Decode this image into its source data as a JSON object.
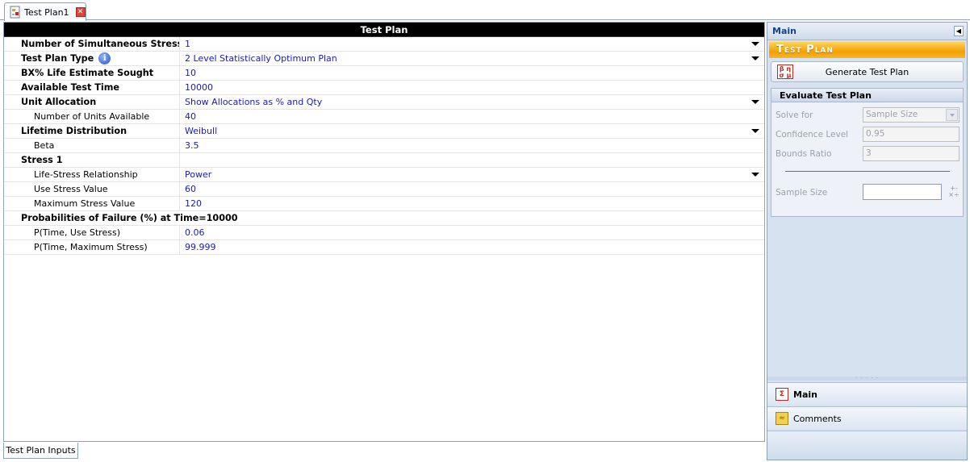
{
  "document_tab": {
    "label": "Test Plan1"
  },
  "grid": {
    "header": "Test Plan",
    "rows": [
      {
        "label": "Number of Simultaneous Stresses",
        "value": "1",
        "bold": true,
        "dropdown": true
      },
      {
        "label": "Test Plan Type",
        "value": "2 Level Statistically Optimum Plan",
        "bold": true,
        "dropdown": true,
        "info": true
      },
      {
        "label": "BX% Life Estimate Sought",
        "value": "10",
        "bold": true
      },
      {
        "label": "Available Test Time",
        "value": "10000",
        "bold": true
      },
      {
        "label": "Unit Allocation",
        "value": "Show Allocations as % and Qty",
        "bold": true,
        "dropdown": true
      },
      {
        "label": "Number of Units Available",
        "value": "40",
        "sub": true
      },
      {
        "label": "Lifetime Distribution",
        "value": "Weibull",
        "bold": true,
        "dropdown": true
      },
      {
        "label": "Beta",
        "value": "3.5",
        "sub": true
      },
      {
        "label": "Stress 1",
        "value": "",
        "bold": true
      },
      {
        "label": "Life-Stress Relationship",
        "value": "Power",
        "sub": true,
        "dropdown": true
      },
      {
        "label": "Use Stress Value",
        "value": "60",
        "sub": true
      },
      {
        "label": "Maximum Stress Value",
        "value": "120",
        "sub": true
      },
      {
        "label": "Probabilities of Failure (%) at Time=10000",
        "value": "",
        "bold": true,
        "wide": true
      },
      {
        "label": "P(Time, Use Stress)",
        "value": "0.06",
        "sub": true
      },
      {
        "label": "P(Time, Maximum Stress)",
        "value": "99.999",
        "sub": true
      }
    ],
    "info_icon_glyph": "i",
    "bottom_tab": "Test Plan Inputs"
  },
  "right_panel": {
    "title": "Main",
    "banner": "Test Plan",
    "generate_button": "Generate Test Plan",
    "evaluate": {
      "title": "Evaluate Test Plan",
      "solve_for_label": "Solve for",
      "solve_for_value": "Sample Size",
      "confidence_label": "Confidence Level",
      "confidence_value": "0.95",
      "bounds_label": "Bounds Ratio",
      "bounds_value": "3",
      "sample_size_label": "Sample Size",
      "sample_size_value": ""
    },
    "nav_main": "Main",
    "nav_comments": "Comments"
  },
  "colors": {
    "grid_header_bg": "#000000",
    "value_text": "#1a1ab8",
    "banner_orange": "#f2a100",
    "panel_bg": "#d7e2f1"
  },
  "icons": {
    "tab_icon": "test-plan-doc-icon",
    "close": "close-icon",
    "info": "info-icon",
    "generate": "formula-icon",
    "calc": "calculator-icon",
    "main_nav": "sigma-sheet-icon",
    "comments_nav": "comments-icon"
  }
}
